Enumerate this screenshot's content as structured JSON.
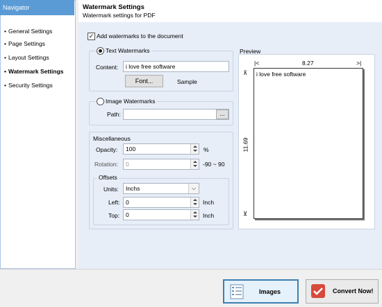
{
  "navigator": {
    "title": "Navigator",
    "items": [
      {
        "label": "General Settings"
      },
      {
        "label": "Page Settings"
      },
      {
        "label": "Layout Settings"
      },
      {
        "label": "Watermark Settings"
      },
      {
        "label": "Security Settings"
      }
    ],
    "bullet": "•"
  },
  "header": {
    "title": "Watermark Settings",
    "subtitle": "Watermark settings for PDF"
  },
  "add_watermarks": {
    "label": "Add watermarks to the document",
    "checked": true,
    "check_glyph": "✓"
  },
  "text_watermarks": {
    "label": "Text Watermarks",
    "content_label": "Content:",
    "content_value": "i love free software",
    "font_button": "Font...",
    "sample_label": "Sample"
  },
  "image_watermarks": {
    "label": "Image Watermarks",
    "path_label": "Path:",
    "path_value": "",
    "browse_button": "..."
  },
  "misc": {
    "title": "Miscellaneous",
    "opacity_label": "Opacity:",
    "opacity_value": "100",
    "opacity_unit": "%",
    "rotation_label": "Rotation:",
    "rotation_value": "0",
    "rotation_range": "-90 ~ 90",
    "offsets_title": "Offsets",
    "units_label": "Units:",
    "units_value": "Inchs",
    "left_label": "Left:",
    "left_value": "0",
    "left_unit": "Inch",
    "top_label": "Top:",
    "top_value": "0",
    "top_unit": "Inch"
  },
  "preview": {
    "title": "Preview",
    "width_value": "8.27",
    "height_value": "11.69",
    "left_marker": "|<",
    "right_marker": ">|",
    "top_marker": "⊼",
    "bottom_marker": "⊻",
    "watermark_text": "i love free software"
  },
  "bottom": {
    "images_button": "Images",
    "convert_button": "Convert Now!"
  }
}
